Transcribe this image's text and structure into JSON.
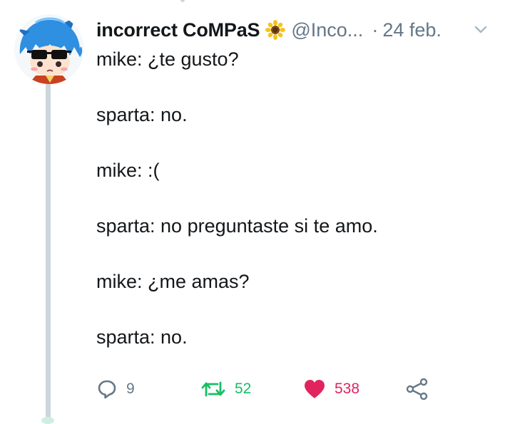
{
  "tweet": {
    "author_name": "incorrect CoMPaS",
    "handle": "@Inco...",
    "separator": "·",
    "date": "24 feb.",
    "lines": [
      "mike: ¿te gusto?",
      "sparta: no.",
      "mike: :(",
      "sparta: no preguntaste si te amo.",
      "mike: ¿me amas?",
      "sparta: no."
    ]
  },
  "actions": {
    "reply_count": "9",
    "retweet_count": "52",
    "like_count": "538"
  },
  "icons": {
    "badge": "sunflower-icon",
    "menu": "chevron-down-icon",
    "reply": "reply-icon",
    "retweet": "retweet-icon",
    "like": "heart-icon",
    "share": "share-icon"
  },
  "colors": {
    "text": "#14171a",
    "muted": "#657786",
    "retweet": "#17bf63",
    "like": "#e0245e",
    "thread_line": "#ccd6dd"
  }
}
